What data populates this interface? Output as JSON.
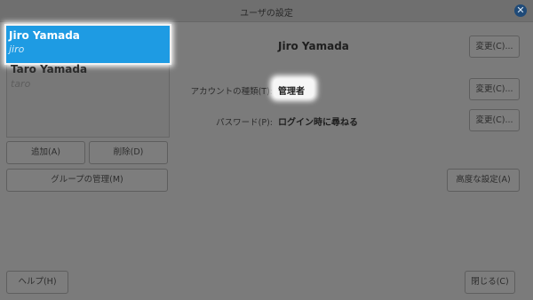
{
  "window": {
    "title": "ユーザの設定"
  },
  "users": [
    {
      "name": "Jiro Yamada",
      "login": "jiro",
      "selected": true
    },
    {
      "name": "Taro Yamada",
      "login": "taro",
      "selected": false
    }
  ],
  "buttons": {
    "add": "追加(A)",
    "delete": "削除(D)",
    "manage_groups": "グループの管理(M)",
    "help": "ヘルプ(H)",
    "close": "閉じる(C)",
    "advanced": "高度な設定(A)",
    "change_name": "変更(C)...",
    "change_account_type": "変更(C)...",
    "change_password": "変更(C)..."
  },
  "details": {
    "display_name": "Jiro Yamada",
    "account_type_label": "アカウントの種類(T):",
    "account_type_value": "管理者",
    "password_label": "パスワード(P):",
    "password_value": "ログイン時に尋ねる"
  },
  "colors": {
    "selection": "#1e9be3",
    "close_icon": "#1f4a78",
    "window_bg": "#7b7b7b"
  },
  "icons": {
    "close": "close-icon"
  }
}
